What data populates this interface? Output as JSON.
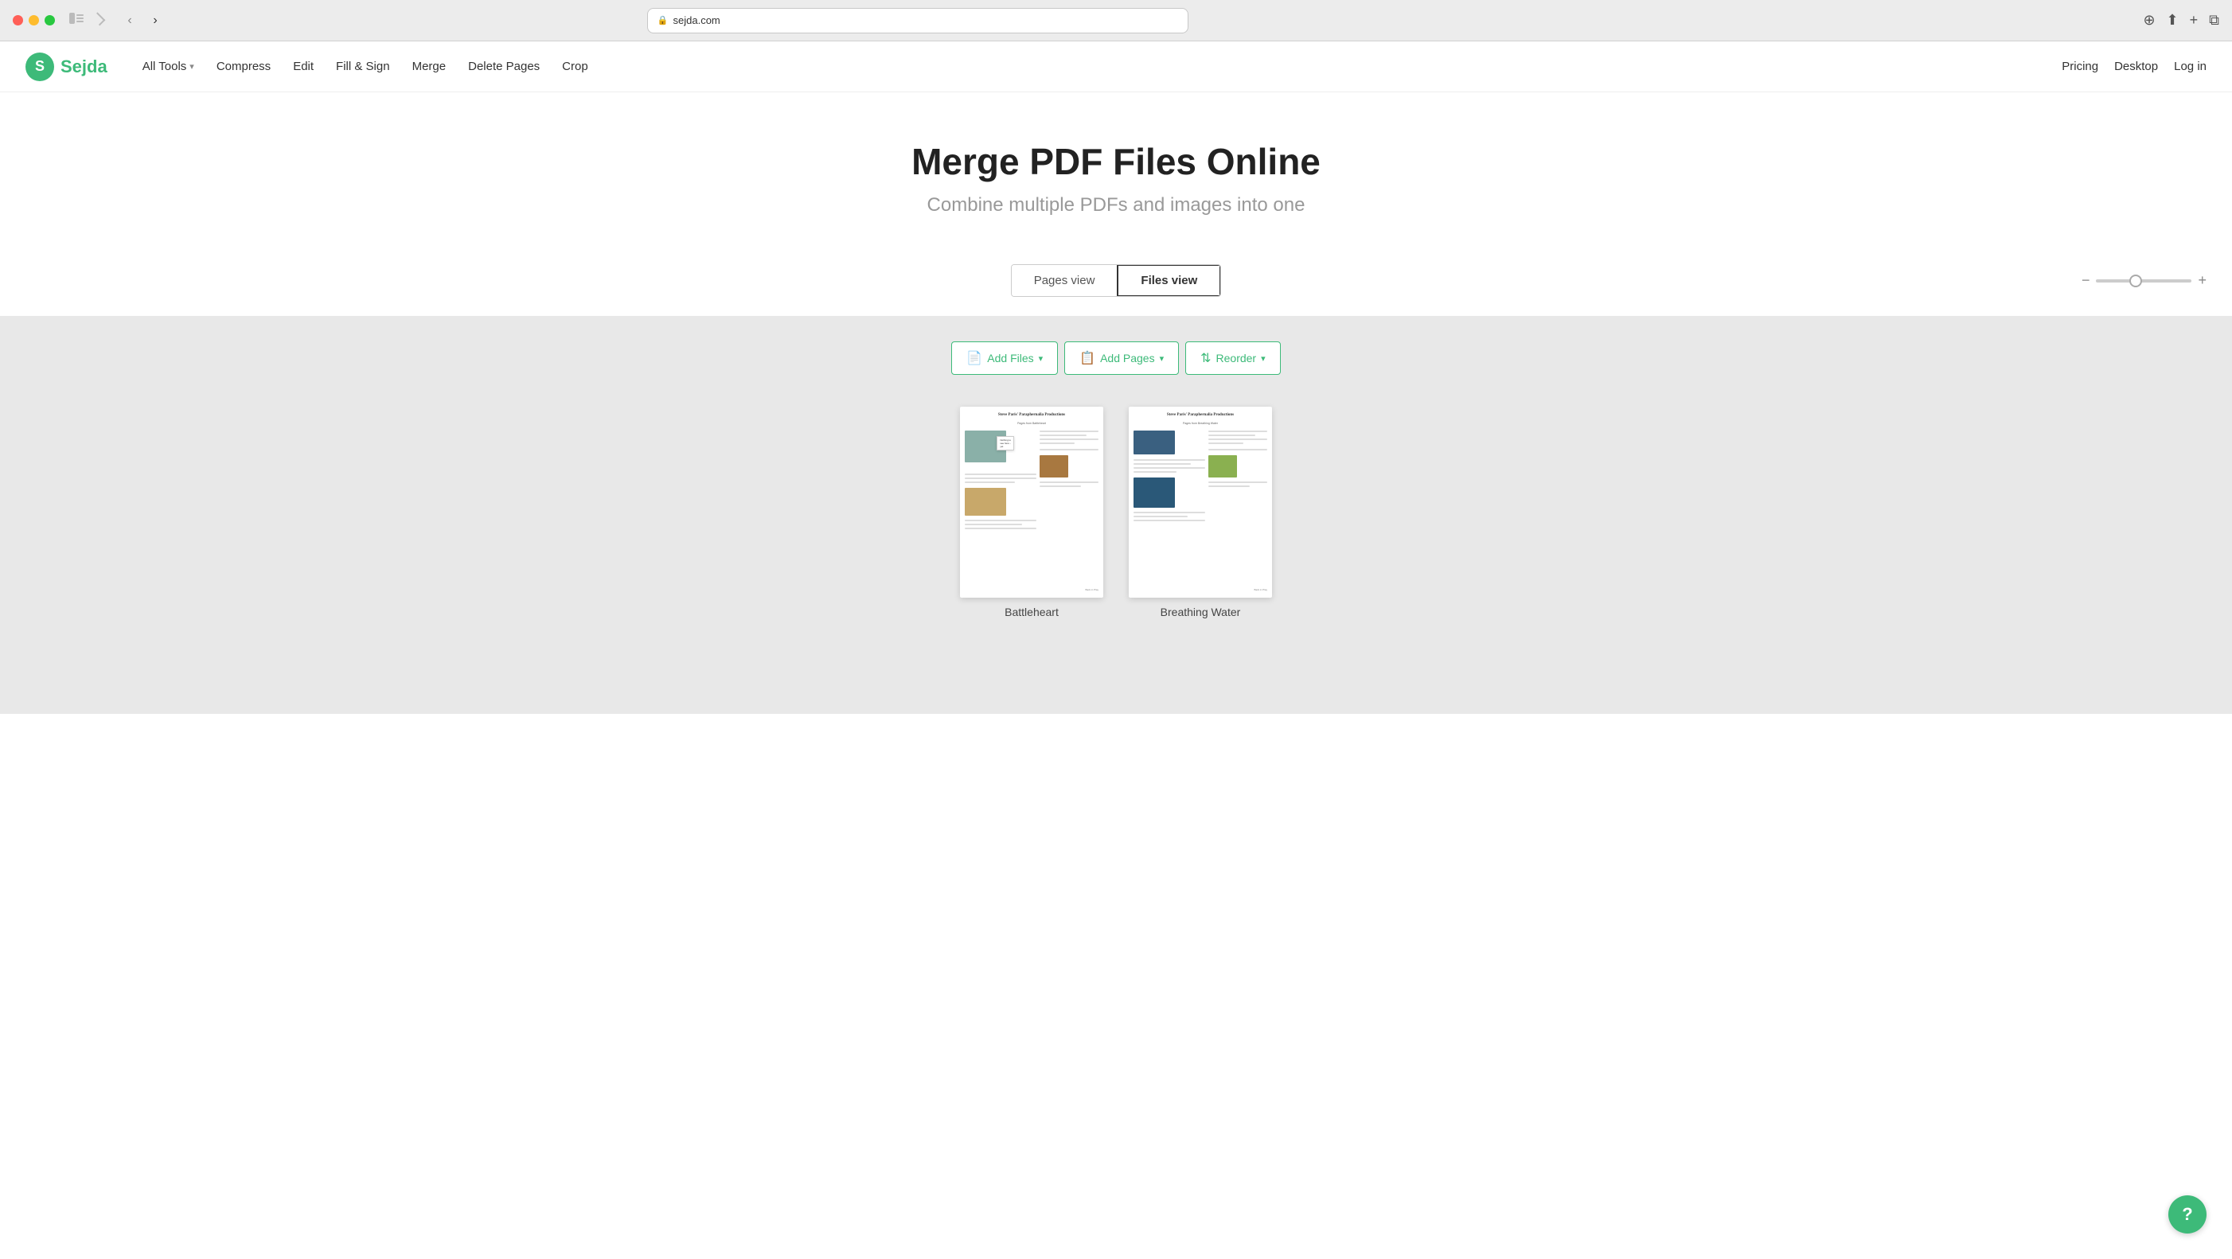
{
  "browser": {
    "url": "sejda.com",
    "lock_icon": "🔒"
  },
  "navbar": {
    "logo_letter": "S",
    "logo_name": "Sejda",
    "nav_items": [
      {
        "label": "All Tools",
        "has_dropdown": true
      },
      {
        "label": "Compress",
        "has_dropdown": false
      },
      {
        "label": "Edit",
        "has_dropdown": false
      },
      {
        "label": "Fill & Sign",
        "has_dropdown": false
      },
      {
        "label": "Merge",
        "has_dropdown": false
      },
      {
        "label": "Delete Pages",
        "has_dropdown": false
      },
      {
        "label": "Crop",
        "has_dropdown": false
      }
    ],
    "right_links": [
      {
        "label": "Pricing"
      },
      {
        "label": "Desktop"
      },
      {
        "label": "Log in"
      }
    ]
  },
  "hero": {
    "title": "Merge PDF Files Online",
    "subtitle": "Combine multiple PDFs and images into one"
  },
  "view_toggle": {
    "pages_view_label": "Pages view",
    "files_view_label": "Files view",
    "active": "files"
  },
  "toolbar": {
    "add_files_label": "Add Files",
    "add_pages_label": "Add Pages",
    "reorder_label": "Reorder"
  },
  "pdf_cards": [
    {
      "label": "Battleheart",
      "id": "battleheart"
    },
    {
      "label": "Breathing Water",
      "id": "breathing-water"
    }
  ],
  "help_btn": {
    "label": "?"
  }
}
